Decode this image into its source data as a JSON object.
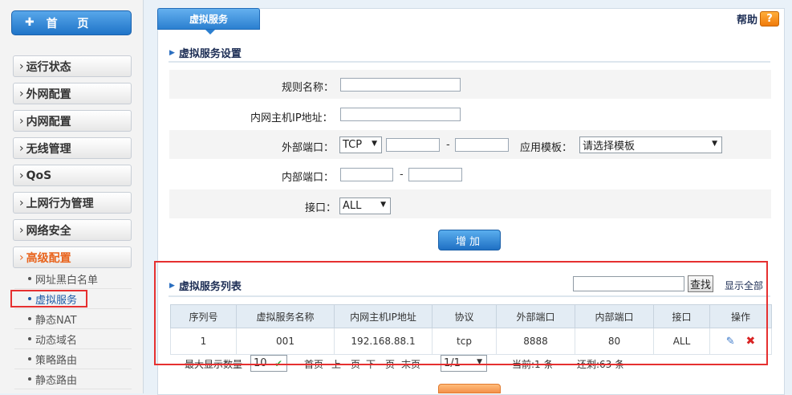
{
  "sidebar": {
    "home_label": "首 页",
    "home_icon": "plus-icon",
    "items": [
      {
        "label": "运行状态"
      },
      {
        "label": "外网配置"
      },
      {
        "label": "内网配置"
      },
      {
        "label": "无线管理"
      },
      {
        "label": "QoS"
      },
      {
        "label": "上网行为管理"
      },
      {
        "label": "网络安全"
      },
      {
        "label": "高级配置"
      }
    ],
    "sub_items": [
      {
        "label": "网址黑白名单"
      },
      {
        "label": "虚拟服务"
      },
      {
        "label": "静态NAT"
      },
      {
        "label": "动态域名"
      },
      {
        "label": "策略路由"
      },
      {
        "label": "静态路由"
      }
    ]
  },
  "tab": {
    "label": "虚拟服务"
  },
  "help": {
    "label": "帮助",
    "icon_text": "?"
  },
  "settings": {
    "title": "虚拟服务设置",
    "rule_name_label": "规则名称：",
    "rule_name_value": "",
    "host_ip_label": "内网主机IP地址：",
    "host_ip_value": "",
    "ext_port_label": "外部端口：",
    "protocol_value": "TCP",
    "ext_port_from": "",
    "ext_port_to": "",
    "template_label": "应用模板：",
    "template_value": "请选择模板",
    "int_port_label": "内部端口：",
    "int_port_from": "",
    "int_port_to": "",
    "iface_label": "接口：",
    "iface_value": "ALL",
    "dash": "-",
    "add_button": "增加"
  },
  "list": {
    "title": "虚拟服务列表",
    "search_value": "",
    "search_button": "查找",
    "show_all": "显示全部",
    "columns": [
      "序列号",
      "虚拟服务名称",
      "内网主机IP地址",
      "协议",
      "外部端口",
      "内部端口",
      "接口",
      "操作"
    ],
    "rows": [
      {
        "index": "1",
        "name": "001",
        "ip": "192.168.88.1",
        "protocol": "tcp",
        "ext_port": "8888",
        "int_port": "80",
        "iface": "ALL"
      }
    ]
  },
  "pager": {
    "max_label": "最大显示数量",
    "max_value": "10",
    "first": "首页",
    "prev": "上一页",
    "next": "下一页",
    "last": "末页",
    "page_value": "1/1",
    "current": "当前:1 条",
    "remaining": "还剩:63 条"
  },
  "colors": {
    "accent": "#2b7fd0",
    "highlight_frame": "#e63030",
    "active_nav": "#e8631c"
  }
}
